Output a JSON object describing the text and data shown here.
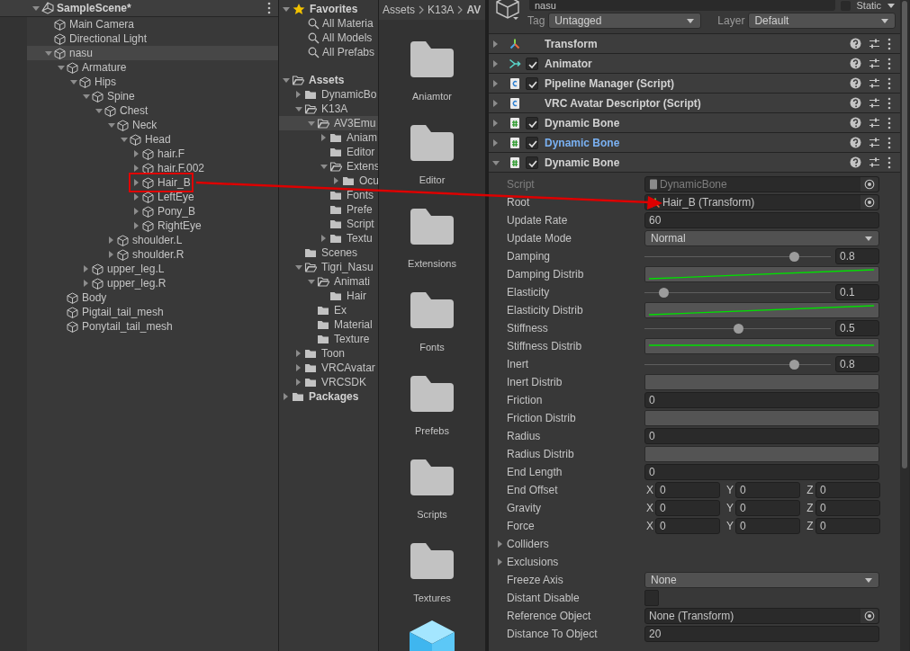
{
  "hierarchy": {
    "scene": "SampleScene*",
    "tree": [
      {
        "label": "Main Camera",
        "selected": false
      },
      {
        "label": "Directional Light",
        "selected": false
      },
      {
        "label": "nasu",
        "expanded": true,
        "selected": true,
        "children": [
          {
            "label": "Armature",
            "expanded": true,
            "selected": false,
            "children": [
              {
                "label": "Hips",
                "expanded": true,
                "selected": false,
                "children": [
                  {
                    "label": "Spine",
                    "expanded": true,
                    "selected": false,
                    "children": [
                      {
                        "label": "Chest",
                        "expanded": true,
                        "selected": false,
                        "children": [
                          {
                            "label": "Neck",
                            "expanded": true,
                            "selected": false,
                            "children": [
                              {
                                "label": "Head",
                                "expanded": true,
                                "selected": false,
                                "children": [
                                  {
                                    "label": "hair.F",
                                    "expanded": false,
                                    "selected": false
                                  },
                                  {
                                    "label": "hair.F.002",
                                    "expanded": false,
                                    "selected": false
                                  },
                                  {
                                    "label": "Hair_B",
                                    "expanded": false,
                                    "selected": false,
                                    "annotated": true
                                  },
                                  {
                                    "label": "LeftEye",
                                    "expanded": false,
                                    "selected": false
                                  },
                                  {
                                    "label": "Pony_B",
                                    "expanded": false,
                                    "selected": false
                                  },
                                  {
                                    "label": "RightEye",
                                    "expanded": false,
                                    "selected": false
                                  }
                                ]
                              }
                            ]
                          },
                          {
                            "label": "shoulder.L",
                            "expanded": false,
                            "selected": false
                          },
                          {
                            "label": "shoulder.R",
                            "expanded": false,
                            "selected": false
                          }
                        ]
                      }
                    ]
                  },
                  {
                    "label": "upper_leg.L",
                    "expanded": false,
                    "selected": false
                  },
                  {
                    "label": "upper_leg.R",
                    "expanded": false,
                    "selected": false
                  }
                ]
              }
            ]
          },
          {
            "label": "Body",
            "selected": false
          },
          {
            "label": "Pigtail_tail_mesh",
            "selected": false
          },
          {
            "label": "Ponytail_tail_mesh",
            "selected": false
          }
        ]
      }
    ]
  },
  "project": {
    "favorites": {
      "title": "Favorites",
      "expanded": true,
      "items": [
        "All Materia",
        "All Models",
        "All Prefabs"
      ]
    },
    "tree": [
      {
        "label": "Assets",
        "expanded": true,
        "selected": false,
        "children": [
          {
            "label": "DynamicBo",
            "expanded": false,
            "selected": false
          },
          {
            "label": "K13A",
            "expanded": true,
            "selected": false,
            "children": [
              {
                "label": "AV3Emu",
                "expanded": true,
                "selected": true,
                "children": [
                  {
                    "label": "Aniam",
                    "expanded": false,
                    "selected": false
                  },
                  {
                    "label": "Editor",
                    "selected": false
                  },
                  {
                    "label": "Extens",
                    "expanded": true,
                    "selected": false,
                    "children": [
                      {
                        "label": "Ocu",
                        "expanded": false,
                        "selected": false
                      }
                    ]
                  },
                  {
                    "label": "Fonts",
                    "selected": false
                  },
                  {
                    "label": "Prefe",
                    "selected": false
                  },
                  {
                    "label": "Script",
                    "selected": false
                  },
                  {
                    "label": "Textu",
                    "expanded": false,
                    "selected": false
                  }
                ]
              }
            ]
          },
          {
            "label": "Scenes",
            "selected": false
          },
          {
            "label": "Tigri_Nasu",
            "expanded": true,
            "selected": false,
            "children": [
              {
                "label": "Animati",
                "expanded": true,
                "selected": false,
                "children": [
                  {
                    "label": "Hair",
                    "selected": false
                  }
                ]
              },
              {
                "label": "Ex",
                "selected": false
              },
              {
                "label": "Material",
                "selected": false
              },
              {
                "label": "Texture",
                "selected": false
              }
            ]
          },
          {
            "label": "Toon",
            "expanded": false,
            "selected": false
          },
          {
            "label": "VRCAvatar",
            "expanded": false,
            "selected": false
          },
          {
            "label": "VRCSDK",
            "expanded": false,
            "selected": false
          }
        ]
      },
      {
        "label": "Packages",
        "expanded": false,
        "selected": false
      }
    ]
  },
  "browser": {
    "breadcrumb": [
      "Assets",
      "K13A",
      "AV"
    ],
    "items": [
      {
        "kind": "folder",
        "label": "Aniamtor"
      },
      {
        "kind": "folder",
        "label": "Editor"
      },
      {
        "kind": "folder",
        "label": "Extensions"
      },
      {
        "kind": "folder",
        "label": "Fonts"
      },
      {
        "kind": "folder",
        "label": "Prefebs"
      },
      {
        "kind": "folder",
        "label": "Scripts"
      },
      {
        "kind": "folder",
        "label": "Textures"
      },
      {
        "kind": "prefab"
      }
    ]
  },
  "inspector": {
    "object_name": "nasu",
    "static_label": "Static",
    "static": false,
    "tag": {
      "label": "Tag",
      "value": "Untagged"
    },
    "layer": {
      "label": "Layer",
      "value": "Default"
    },
    "components": [
      {
        "kind": "transform",
        "title": "Transform",
        "expanded": false,
        "overridden": false
      },
      {
        "kind": "animator",
        "title": "Animator",
        "checked": true,
        "expanded": false,
        "overridden": false
      },
      {
        "kind": "csharp",
        "title": "Pipeline Manager (Script)",
        "checked": true,
        "expanded": false,
        "overridden": false
      },
      {
        "kind": "csharp",
        "title": "VRC Avatar Descriptor (Script)",
        "expanded": false,
        "overridden": false
      },
      {
        "kind": "hash",
        "title": "Dynamic Bone",
        "checked": true,
        "expanded": false,
        "overridden": false
      },
      {
        "kind": "hash",
        "title": "Dynamic Bone",
        "checked": true,
        "expanded": false,
        "overridden": true
      },
      {
        "kind": "hash",
        "title": "Dynamic Bone",
        "checked": true,
        "expanded": true,
        "overridden": false
      }
    ],
    "properties": [
      {
        "kind": "script_ref",
        "label": "Script",
        "value": "DynamicBone",
        "disabled": true
      },
      {
        "kind": "transform_ref",
        "label": "Root",
        "value": "Hair_B (Transform)",
        "disabled": false
      },
      {
        "kind": "field",
        "label": "Update Rate",
        "value": "60"
      },
      {
        "kind": "dropdown",
        "label": "Update Mode",
        "value": "Normal"
      },
      {
        "kind": "slider",
        "label": "Damping",
        "level": 0.8,
        "reading": "0.8"
      },
      {
        "kind": "rising_curve",
        "label": "Damping Distrib"
      },
      {
        "kind": "slider",
        "label": "Elasticity",
        "level": 0.1,
        "reading": "0.1"
      },
      {
        "kind": "rising_curve",
        "label": "Elasticity Distrib"
      },
      {
        "kind": "slider",
        "label": "Stiffness",
        "level": 0.5,
        "reading": "0.5"
      },
      {
        "kind": "flat_curve",
        "label": "Stiffness Distrib"
      },
      {
        "kind": "slider",
        "label": "Inert",
        "level": 0.8,
        "reading": "0.8"
      },
      {
        "kind": "empty_curve",
        "label": "Inert Distrib"
      },
      {
        "kind": "field",
        "label": "Friction",
        "value": "0"
      },
      {
        "kind": "empty_curve",
        "label": "Friction Distrib"
      },
      {
        "kind": "field",
        "label": "Radius",
        "value": "0"
      },
      {
        "kind": "empty_curve",
        "label": "Radius Distrib"
      },
      {
        "kind": "field",
        "label": "End Length",
        "value": "0"
      },
      {
        "kind": "vector",
        "label": "End Offset",
        "axes": [
          {
            "axis": "X",
            "value": "0"
          },
          {
            "axis": "Y",
            "value": "0"
          },
          {
            "axis": "Z",
            "value": "0"
          }
        ]
      },
      {
        "kind": "vector",
        "label": "Gravity",
        "axes": [
          {
            "axis": "X",
            "value": "0"
          },
          {
            "axis": "Y",
            "value": "0"
          },
          {
            "axis": "Z",
            "value": "0"
          }
        ]
      },
      {
        "kind": "vector",
        "label": "Force",
        "axes": [
          {
            "axis": "X",
            "value": "0"
          },
          {
            "axis": "Y",
            "value": "0"
          },
          {
            "axis": "Z",
            "value": "0"
          }
        ]
      },
      {
        "kind": "foldout",
        "label": "Colliders",
        "expanded": false
      },
      {
        "kind": "foldout",
        "label": "Exclusions",
        "expanded": false
      },
      {
        "kind": "dropdown",
        "label": "Freeze Axis",
        "value": "None"
      },
      {
        "kind": "checkbox",
        "label": "Distant Disable",
        "checked": false
      },
      {
        "kind": "object",
        "label": "Reference Object",
        "value": "None (Transform)",
        "disabled": false
      },
      {
        "kind": "field",
        "label": "Distance To Object",
        "value": "20"
      }
    ]
  }
}
